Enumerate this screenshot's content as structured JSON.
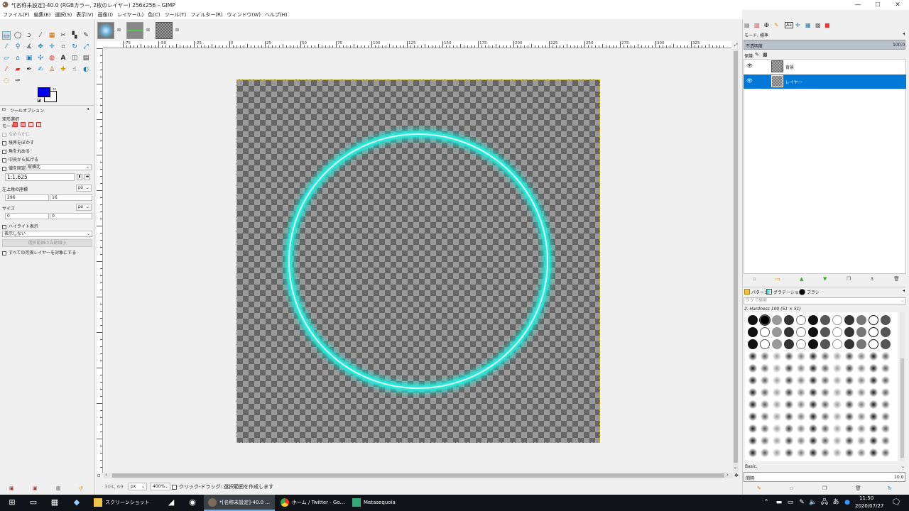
{
  "window": {
    "title": "*[名称未設定]-40.0 (RGBカラー, 2枚のレイヤー) 256x256 – GIMP",
    "controls": [
      "—",
      "☐",
      "✕"
    ]
  },
  "menu": [
    "ファイル(F)",
    "編集(E)",
    "選択(S)",
    "表示(V)",
    "画像(I)",
    "レイヤー(L)",
    "色(C)",
    "ツール(T)",
    "フィルター(R)",
    "ウィンドウ(W)",
    "ヘルプ(H)"
  ],
  "tool_options": {
    "panel_title": "ツールオプション",
    "tool_name": "矩形選択",
    "mode_label": "モード:",
    "antialias": "なめらかに",
    "feather": "境界をぼかす",
    "rounded": "角を丸める",
    "expand_center": "中央から拡げる",
    "fixed_label": "値を固定",
    "fixed_value": "縦横比",
    "ratio": "1:1.625",
    "position_label": "左上角の座標",
    "position_unit": "px",
    "position_x": "296",
    "position_y": "16",
    "size_label": "サイズ",
    "size_unit": "px",
    "size_w": "0",
    "size_h": "0",
    "highlight": "ハイライト表示",
    "guides": "表示しない",
    "auto_shrink": "選択範囲の自動縮小",
    "all_layers": "すべての可視レイヤーを対象にする"
  },
  "ruler_labels": [
    "-75",
    "-50",
    "-25",
    "0",
    "25",
    "50",
    "75",
    "100",
    "125",
    "150",
    "175",
    "200",
    "225",
    "250",
    "275",
    "300",
    "325"
  ],
  "status": {
    "coords": "304, 69",
    "unit": "px",
    "zoom": "400%",
    "message": "クリック-ドラッグ: 選択範囲を作成します"
  },
  "layers_panel": {
    "mode_label": "モード:",
    "mode_value": "標準",
    "opacity_label": "不透明度",
    "opacity_value": "100.0",
    "lock_label": "保護:",
    "layers": [
      {
        "name": "背景",
        "selected": false
      },
      {
        "name": "レイヤー",
        "selected": true
      }
    ]
  },
  "brushes_panel": {
    "tabs": [
      "パターン",
      "グラデーション",
      "ブラシ"
    ],
    "search_placeholder": "タグで検索",
    "brush_name": "2. Hardness 100 (51 × 51)",
    "preset": "Basic,",
    "spacing_label": "間隔",
    "spacing_value": "10.0"
  },
  "taskbar": {
    "items": [
      "スクリーンショット",
      "*[名称未設定]-40.0 ...",
      "ホーム / Twitter - Go...",
      "Metasequoia"
    ],
    "time": "11:50",
    "date": "2020/07/27"
  },
  "colors": {
    "foreground": "#0000ee",
    "background": "#ffffff",
    "ring": "#27e8d8",
    "selected_layer": "#0078d7"
  }
}
